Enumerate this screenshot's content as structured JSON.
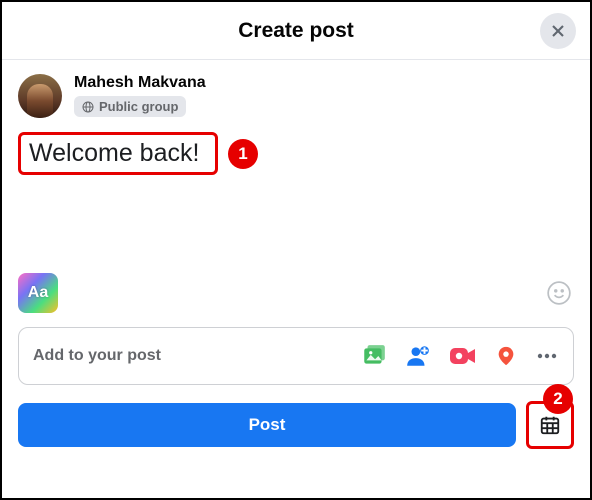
{
  "header": {
    "title": "Create post"
  },
  "author": {
    "name": "Mahesh Makvana",
    "audience_label": "Public group"
  },
  "post": {
    "text": "Welcome back!"
  },
  "addto": {
    "label": "Add to your post"
  },
  "footer": {
    "post_label": "Post"
  },
  "callouts": {
    "one": "1",
    "two": "2"
  }
}
